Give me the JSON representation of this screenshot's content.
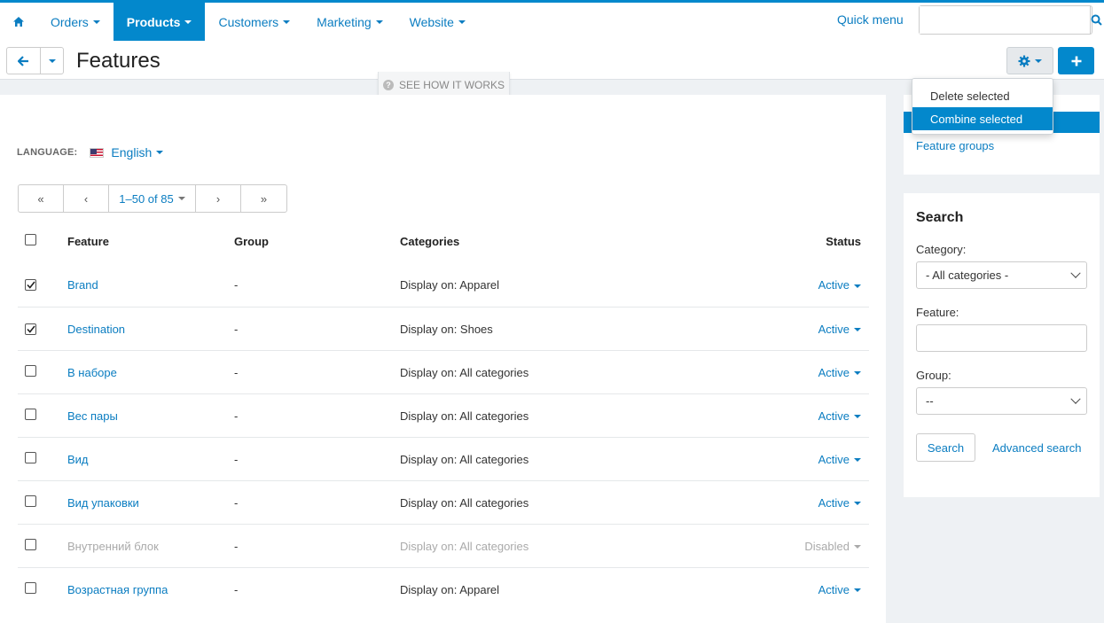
{
  "colors": {
    "accent": "#0388cc",
    "link": "#0b7dc1"
  },
  "nav": {
    "home_icon": "home-icon",
    "items": [
      {
        "label": "Orders",
        "active": false
      },
      {
        "label": "Products",
        "active": true
      },
      {
        "label": "Customers",
        "active": false
      },
      {
        "label": "Marketing",
        "active": false
      },
      {
        "label": "Website",
        "active": false
      }
    ],
    "quick_menu": "Quick menu",
    "search_value": ""
  },
  "title": {
    "text": "Features"
  },
  "how_it_works": "SEE HOW IT WORKS",
  "actions_menu": {
    "items": [
      "Delete selected",
      "Combine selected"
    ],
    "hovered": "Combine selected"
  },
  "language": {
    "label": "LANGUAGE:",
    "value": "English"
  },
  "pager": {
    "first": "«",
    "prev": "‹",
    "range": "1–50 of 85",
    "next": "›",
    "last": "»"
  },
  "table": {
    "headers": {
      "feature": "Feature",
      "group": "Group",
      "categories": "Categories",
      "status": "Status"
    },
    "rows": [
      {
        "checked": true,
        "feature": "Brand",
        "group": "-",
        "categories": "Display on: Apparel",
        "status": "Active",
        "disabled": false
      },
      {
        "checked": true,
        "feature": "Destination",
        "group": "-",
        "categories": "Display on: Shoes",
        "status": "Active",
        "disabled": false
      },
      {
        "checked": false,
        "feature": "В наборе",
        "group": "-",
        "categories": "Display on: All categories",
        "status": "Active",
        "disabled": false
      },
      {
        "checked": false,
        "feature": "Вес пары",
        "group": "-",
        "categories": "Display on: All categories",
        "status": "Active",
        "disabled": false
      },
      {
        "checked": false,
        "feature": "Вид",
        "group": "-",
        "categories": "Display on: All categories",
        "status": "Active",
        "disabled": false
      },
      {
        "checked": false,
        "feature": "Вид упаковки",
        "group": "-",
        "categories": "Display on: All categories",
        "status": "Active",
        "disabled": false
      },
      {
        "checked": false,
        "feature": "Внутренний блок",
        "group": "-",
        "categories": "Display on: All categories",
        "status": "Disabled",
        "disabled": true
      },
      {
        "checked": false,
        "feature": "Возрастная группа",
        "group": "-",
        "categories": "Display on: Apparel",
        "status": "Active",
        "disabled": false
      }
    ]
  },
  "sidebar": {
    "link": "Feature groups"
  },
  "search": {
    "title": "Search",
    "category_label": "Category:",
    "category_value": "- All categories -",
    "feature_label": "Feature:",
    "feature_value": "",
    "group_label": "Group:",
    "group_value": "--",
    "search_button": "Search",
    "advanced_link": "Advanced search"
  }
}
